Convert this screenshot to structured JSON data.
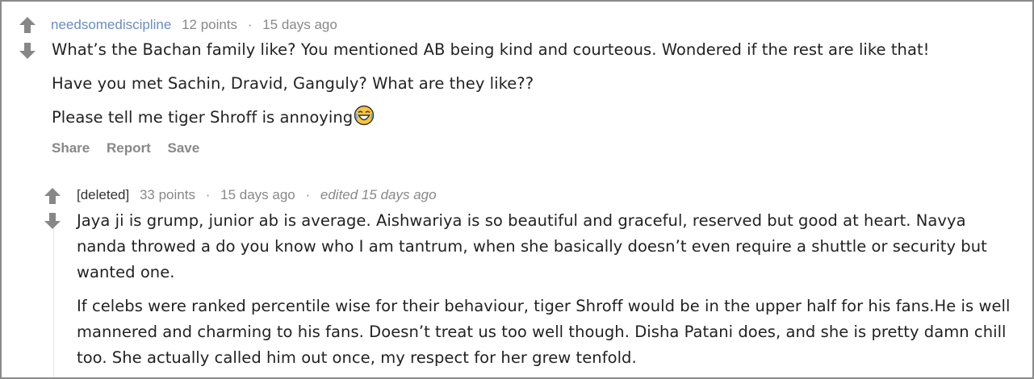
{
  "comments": [
    {
      "author": "needsomediscipline",
      "points": "12 points",
      "time": "15 days ago",
      "paragraphs": [
        "What’s the Bachan family like? You mentioned AB being kind and courteous. Wondered if the rest are like that!",
        "Have you met Sachin, Dravid, Ganguly? What are they like??",
        "Please tell me tiger Shroff is annoying"
      ],
      "actions": [
        "Share",
        "Report",
        "Save"
      ]
    },
    {
      "author": "[deleted]",
      "points": "33 points",
      "time": "15 days ago",
      "edited": "edited 15 days ago",
      "paragraphs": [
        "Jaya ji is grump, junior ab is average. Aishwariya is so beautiful and graceful, reserved but good at heart. Navya nanda throwed a do you know who I am tantrum, when she basically doesn’t even require a shuttle or security but wanted one.",
        "If celebs were ranked percentile wise for their behaviour, tiger Shroff would be in the upper half for his fans.He is well mannered and charming to his fans. Doesn’t treat us too well though. Disha Patani does, and she is pretty damn chill too. She actually called him out once, my respect for her grew tenfold."
      ]
    }
  ],
  "icons": {
    "upvote": "arrow-up-icon",
    "downvote": "arrow-down-icon",
    "emoji": "laughing-face-emoji"
  },
  "colors": {
    "author": "#6a8cc0",
    "meta": "#888888",
    "arrow": "#878787",
    "text": "#222222"
  }
}
